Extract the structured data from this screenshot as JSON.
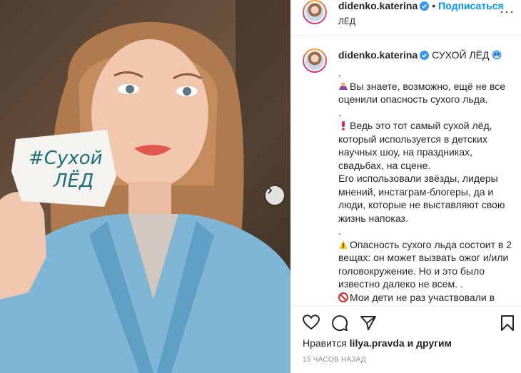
{
  "post": {
    "photo_sign_line1": "#Сухой",
    "photo_sign_line2": "ЛЁД"
  },
  "header": {
    "username": "didenko.katerina",
    "separator": "•",
    "follow_label": "Подписаться",
    "subtitle": "ЛЁД",
    "more_label": "···"
  },
  "caption": {
    "username": "didenko.katerina",
    "title": "СУХОЙ ЛЁД",
    "lines": [
      ".",
      "Вы знаете, возможно, ещё не все оценили опасность сухого льда.",
      ".",
      "Ведь это тот самый сухой лёд, который используется в детских научных шоу, на праздниках, свадьбах, на сцене.",
      "Его использовали звёзды, лидеры мнений, инстаграм-блогеры, да и люди, которые не выставляют свою жизнь напоказ.",
      ".",
      "Опасность сухого льда состоит в 2 вещах: он может вызвать ожог и/или головокружение. Но и это было известно далеко не всем. .",
      "Мои дети не раз участвовали в детских научных шоу с"
    ]
  },
  "footer": {
    "likes_prefix": "Нравится",
    "likes_user": "lilya.pravda",
    "likes_suffix": "и другим",
    "time": "15 ЧАСОВ НАЗАД"
  },
  "colors": {
    "accent": "#0095f6",
    "secondary_text": "#8e8e8e",
    "border": "#efefef"
  },
  "icons": [
    "verified-badge-icon",
    "more-icon",
    "heart-icon",
    "comment-icon",
    "share-icon",
    "bookmark-icon",
    "chevron-right-icon"
  ]
}
